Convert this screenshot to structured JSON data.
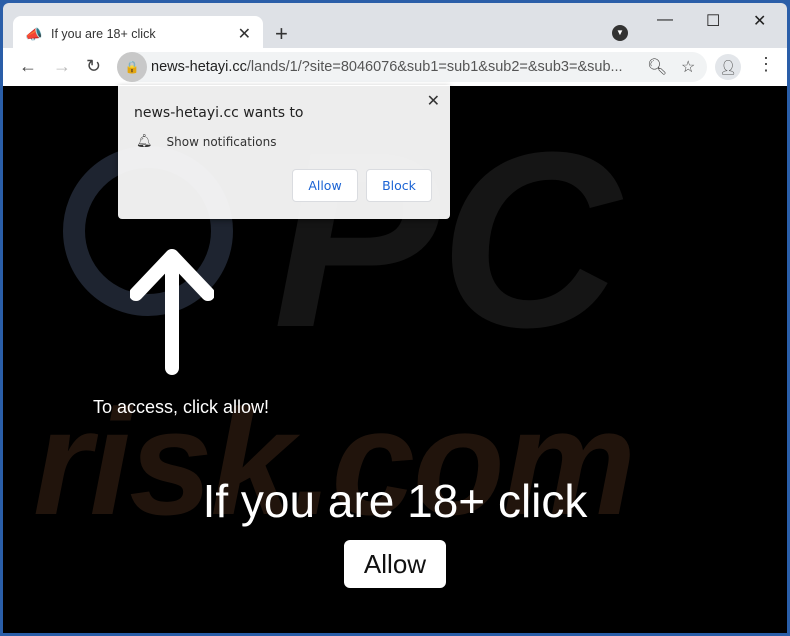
{
  "tab": {
    "title": "If you are 18+ click",
    "favicon": "megaphone-icon"
  },
  "toolbar": {
    "url_domain": "news-hetayi.cc",
    "url_path": "/lands/1/?site=8046076&sub1=sub1&sub2=&sub3=&sub..."
  },
  "popup": {
    "title": "news-hetayi.cc wants to",
    "permission": "Show notifications",
    "allow_label": "Allow",
    "block_label": "Block"
  },
  "page": {
    "instruction": "To access, click allow!",
    "headline": "If you are 18+ click",
    "allow_label": "Allow"
  },
  "watermark": {
    "text": "PC risk.com"
  },
  "colors": {
    "frame": "#2a5ea8",
    "accent_button_text": "#1a63d4",
    "page_bg": "#000000"
  }
}
